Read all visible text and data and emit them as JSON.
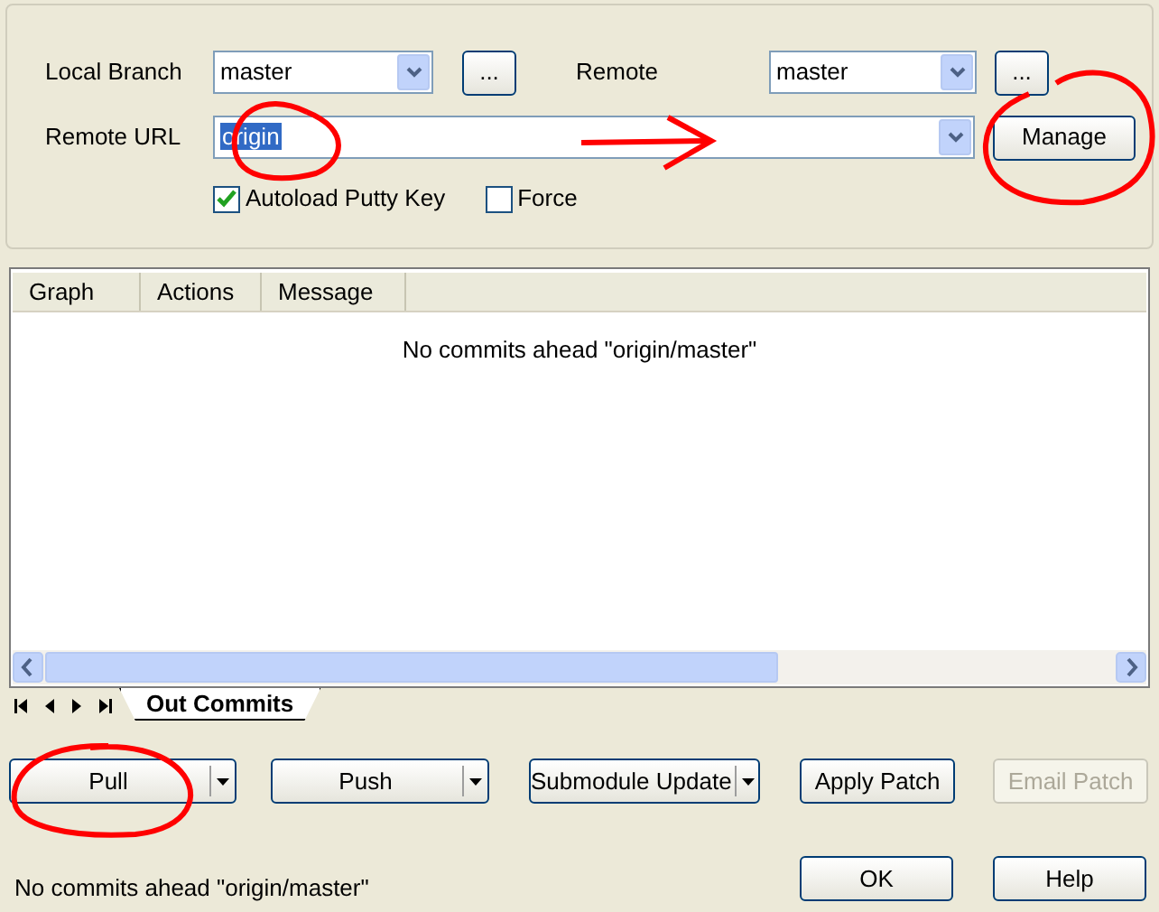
{
  "branch_panel": {
    "local_branch": {
      "label": "Local Branch",
      "value": "master"
    },
    "local_branch_button": "...",
    "remote": {
      "label": "Remote",
      "value": "master"
    },
    "remote_button": "...",
    "remote_url": {
      "label": "Remote URL",
      "value": "origin",
      "highlighted": true
    },
    "manage_button": "Manage",
    "options": [
      {
        "label": "Autoload Putty Key",
        "checked": true
      },
      {
        "label": "Force",
        "checked": false
      }
    ]
  },
  "commits_grid": {
    "columns": [
      "Graph",
      "Actions",
      "Message"
    ],
    "empty_message": "No commits ahead \"origin/master\""
  },
  "tabs": [
    {
      "label": "Out Commits",
      "selected": true
    }
  ],
  "actions": [
    {
      "label": "Pull",
      "kind": "split",
      "disabled": false
    },
    {
      "label": "Push",
      "kind": "split",
      "disabled": false
    },
    {
      "label": "Submodule Update",
      "kind": "split",
      "disabled": false
    },
    {
      "label": "Apply Patch",
      "kind": "plain",
      "disabled": false
    },
    {
      "label": "Email Patch",
      "kind": "plain",
      "disabled": true
    }
  ],
  "status_bar": {
    "text": "No commits ahead \"origin/master\""
  },
  "dialog_buttons": [
    "OK",
    "Help"
  ]
}
